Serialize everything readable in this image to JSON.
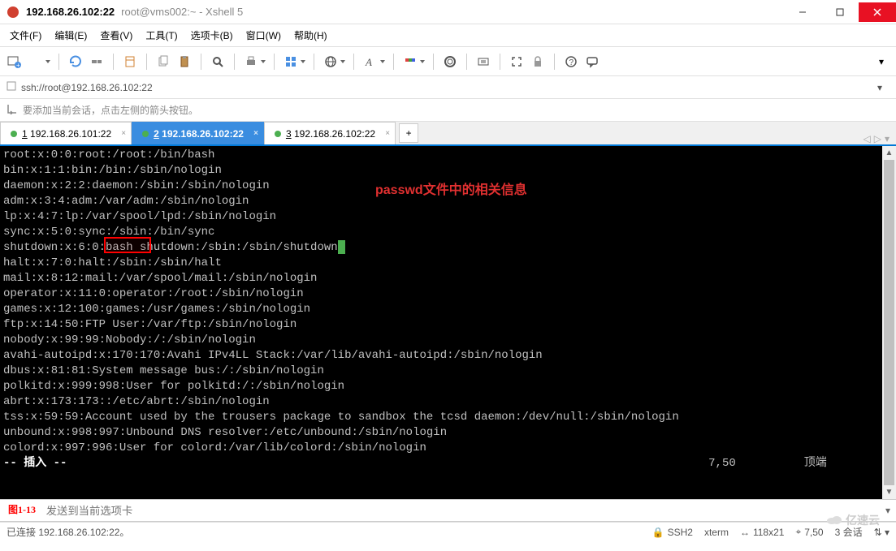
{
  "titlebar": {
    "main": "192.168.26.102:22",
    "sub": "root@vms002:~ - Xshell 5"
  },
  "menubar": {
    "items": [
      "文件(F)",
      "编辑(E)",
      "查看(V)",
      "工具(T)",
      "选项卡(B)",
      "窗口(W)",
      "帮助(H)"
    ]
  },
  "address": "ssh://root@192.168.26.102:22",
  "hint": "要添加当前会话，点击左侧的箭头按钮。",
  "tabs": [
    {
      "num": "1",
      "label": "192.168.26.101:22",
      "active": false
    },
    {
      "num": "2",
      "label": "192.168.26.102:22",
      "active": true
    },
    {
      "num": "3",
      "label": "192.168.26.102:22",
      "active": false
    }
  ],
  "tab_add": "+",
  "annotation": "passwd文件中的相关信息",
  "terminal_lines": [
    "root:x:0:0:root:/root:/bin/bash",
    "bin:x:1:1:bin:/bin:/sbin/nologin",
    "daemon:x:2:2:daemon:/sbin:/sbin/nologin",
    "adm:x:3:4:adm:/var/adm:/sbin/nologin",
    "lp:x:4:7:lp:/var/spool/lpd:/sbin/nologin",
    "sync:x:5:0:sync:/sbin:/bin/sync",
    "shutdown:x:6:0:bash shutdown:/sbin:/sbin/shutdown",
    "halt:x:7:0:halt:/sbin:/sbin/halt",
    "mail:x:8:12:mail:/var/spool/mail:/sbin/nologin",
    "operator:x:11:0:operator:/root:/sbin/nologin",
    "games:x:12:100:games:/usr/games:/sbin/nologin",
    "ftp:x:14:50:FTP User:/var/ftp:/sbin/nologin",
    "nobody:x:99:99:Nobody:/:/sbin/nologin",
    "avahi-autoipd:x:170:170:Avahi IPv4LL Stack:/var/lib/avahi-autoipd:/sbin/nologin",
    "dbus:x:81:81:System message bus:/:/sbin/nologin",
    "polkitd:x:999:998:User for polkitd:/:/sbin/nologin",
    "abrt:x:173:173::/etc/abrt:/sbin/nologin",
    "tss:x:59:59:Account used by the trousers package to sandbox the tcsd daemon:/dev/null:/sbin/nologin",
    "unbound:x:998:997:Unbound DNS resolver:/etc/unbound:/sbin/nologin",
    "colord:x:997:996:User for colord:/var/lib/colord:/sbin/nologin"
  ],
  "vim_mode": "-- 插入 --",
  "vim_pos": "7,50",
  "vim_scroll": "顶端",
  "fig_label": "图1-13",
  "input_placeholder": "发送到当前选项卡",
  "statusbar": {
    "connected": "已连接 192.168.26.102:22。",
    "proto": "SSH2",
    "term": "xterm",
    "size": "118x21",
    "cursor": "7,50",
    "sessions": "3 会话"
  },
  "watermark": "亿速云"
}
